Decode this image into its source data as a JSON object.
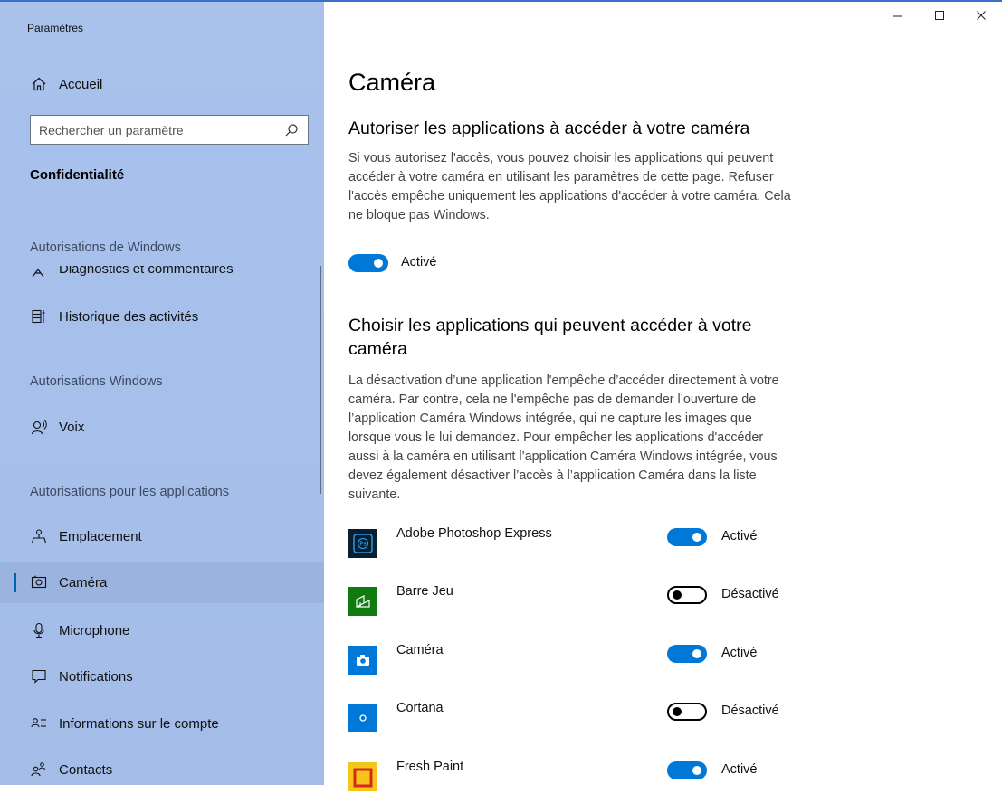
{
  "window": {
    "title": "Paramètres"
  },
  "sidebar": {
    "home_label": "Accueil",
    "search": {
      "placeholder": "Rechercher un paramètre"
    },
    "category": "Confidentialité",
    "group_windows_perms": "Autorisations de Windows",
    "partial_item": "Diagnostics et commentaires",
    "activity_history": "Historique des activités",
    "group_windows": "Autorisations Windows",
    "voice": "Voix",
    "group_apps": "Autorisations pour les applications",
    "items": [
      {
        "label": "Emplacement",
        "icon": "location-icon"
      },
      {
        "label": "Caméra",
        "icon": "camera-icon",
        "selected": true
      },
      {
        "label": "Microphone",
        "icon": "microphone-icon"
      },
      {
        "label": "Notifications",
        "icon": "notification-icon"
      },
      {
        "label": "Informations sur le compte",
        "icon": "account-info-icon"
      },
      {
        "label": "Contacts",
        "icon": "contacts-icon"
      }
    ]
  },
  "main": {
    "title": "Caméra",
    "section1": {
      "heading": "Autoriser les applications à accéder à votre caméra",
      "description": "Si vous autorisez l'accès, vous pouvez choisir les applications qui peuvent accéder à votre caméra en utilisant les paramètres de cette page. Refuser l'accès empêche uniquement les applications d'accéder à votre caméra. Cela ne bloque pas Windows.",
      "toggle_state": "Activé",
      "toggle_on": true
    },
    "section2": {
      "heading": "Choisir les applications qui peuvent accéder à votre caméra",
      "description": "La désactivation d’une application l'empêche d’accéder directement à votre caméra. Par contre, cela ne l'empêche pas de demander l’ouverture de l’application Caméra Windows intégrée, qui ne capture les images que lorsque vous le lui demandez. Pour empêcher les applications d'accéder aussi à la caméra en utilisant l’application Caméra Windows intégrée, vous devez également désactiver l’accès à l’application Caméra dans la liste suivante."
    },
    "apps": [
      {
        "name": "Adobe Photoshop Express",
        "status": "Activé",
        "on": true,
        "icon": "photoshop-express-icon",
        "color": "#0b1e2e"
      },
      {
        "name": "Barre Jeu",
        "status": "Désactivé",
        "on": false,
        "icon": "game-bar-icon",
        "color": "#107c10"
      },
      {
        "name": "Caméra",
        "status": "Activé",
        "on": true,
        "icon": "camera-app-icon",
        "color": "#0078d7"
      },
      {
        "name": "Cortana",
        "status": "Désactivé",
        "on": false,
        "icon": "cortana-icon",
        "color": "#0078d7"
      },
      {
        "name": "Fresh Paint",
        "status": "Activé",
        "on": true,
        "icon": "fresh-paint-icon",
        "color": "#f5c518"
      }
    ]
  },
  "colors": {
    "accent": "#0078d7",
    "sidebar_bg": "#a9c2ec",
    "selected_bg": "#9bb4df"
  }
}
